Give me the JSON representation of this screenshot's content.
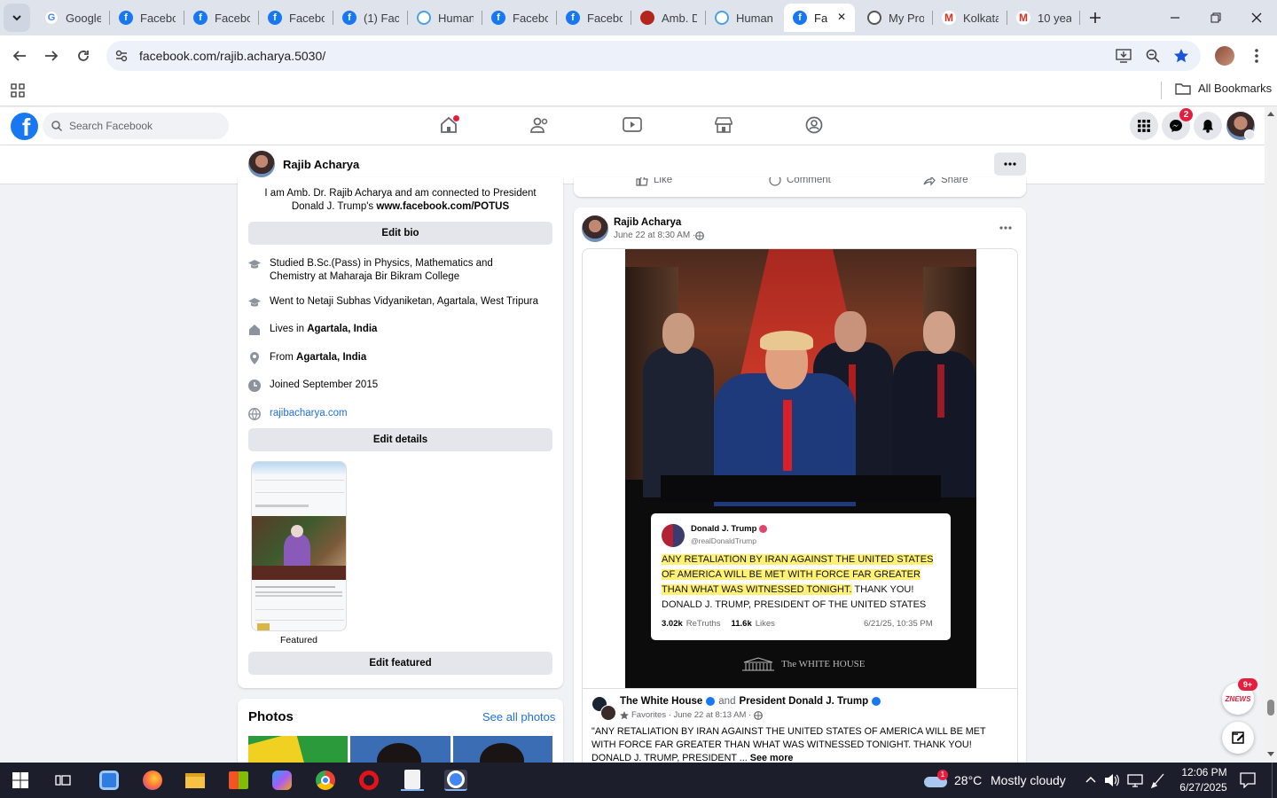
{
  "browser": {
    "tabs": [
      {
        "label": "Google",
        "favicon": "google-icon"
      },
      {
        "label": "Facebo",
        "favicon": "facebook-icon"
      },
      {
        "label": "Facebo",
        "favicon": "facebook-icon"
      },
      {
        "label": "Facebo",
        "favicon": "facebook-icon"
      },
      {
        "label": "(1) Fac",
        "favicon": "facebook-icon"
      },
      {
        "label": "Human",
        "favicon": "globe-icon"
      },
      {
        "label": "Facebo",
        "favicon": "facebook-icon"
      },
      {
        "label": "Facebo",
        "favicon": "facebook-icon"
      },
      {
        "label": "Amb. D",
        "favicon": "avatar-icon"
      },
      {
        "label": "Human",
        "favicon": "globe-icon"
      },
      {
        "label": "Fa",
        "favicon": "facebook-icon"
      },
      {
        "label": "My Pro",
        "favicon": "world-icon"
      },
      {
        "label": "Kolkata",
        "favicon": "gmail-icon"
      },
      {
        "label": "10 yea",
        "favicon": "gmail-icon"
      }
    ],
    "url": "facebook.com/rajib.acharya.5030/",
    "bookmarks_label": "All Bookmarks"
  },
  "facebook": {
    "search_placeholder": "Search Facebook",
    "messenger_badge": "2",
    "profile_name": "Rajib Acharya"
  },
  "intro": {
    "bio": "I am Amb. Dr. Rajib Acharya and am connected to President Donald J. Trump's",
    "bio_link": "www.facebook.com/POTUS",
    "edit_bio": "Edit bio",
    "studied": "Studied B.Sc.(Pass) in Physics, Mathematics and Chemistry at Maharaja Bir Bikram College",
    "went_to": "Went to Netaji Subhas Vidyaniketan, Agartala, West Tripura",
    "lives_prefix": "Lives in ",
    "lives": "Agartala, India",
    "from_prefix": "From ",
    "from": "Agartala, India",
    "joined": "Joined September 2015",
    "website": "rajibacharya.com",
    "edit_details": "Edit details",
    "featured_label": "Featured",
    "edit_featured": "Edit featured"
  },
  "photos": {
    "title": "Photos",
    "see_all": "See all photos"
  },
  "prev_post_actions": {
    "like": "Like",
    "comment": "Comment",
    "share": "Share"
  },
  "post": {
    "author": "Rajib Acharya",
    "time": "June 22 at 8:30 AM · ",
    "tweet": {
      "name": "Donald J. Trump",
      "handle": "@realDonaldTrump",
      "highlight": "ANY RETALIATION BY IRAN AGAINST THE UNITED STATES OF AMERICA WILL BE MET WITH FORCE FAR GREATER THAN WHAT WAS WITNESSED TONIGHT.",
      "rest": " THANK YOU! DONALD J. TRUMP, PRESIDENT OF THE UNITED STATES",
      "retruths": "3.02k",
      "retruths_label": "ReTruths",
      "likes": "11.6k",
      "likes_label": "Likes",
      "date": "6/21/25, 10:35 PM"
    },
    "watermark": "The WHITE HOUSE",
    "shared_from_1": "The White House",
    "shared_and": "and",
    "shared_from_2": "President Donald J. Trump",
    "shared_meta": "Favorites · June 22 at 8:13 AM · ",
    "shared_text": "\"ANY RETALIATION BY IRAN AGAINST THE UNITED STATES OF AMERICA WILL BE MET WITH FORCE FAR GREATER THAN WHAT WAS WITNESSED TONIGHT. THANK YOU! DONALD J. TRUMP, PRESIDENT ...",
    "see_more": "See more"
  },
  "news_widget": {
    "badge": "9+",
    "label": "ZNEWS"
  },
  "taskbar": {
    "temperature": "28°C",
    "weather": "Mostly cloudy",
    "weather_badge": "1",
    "time": "12:06 PM",
    "date": "6/27/2025"
  },
  "colors": {
    "fb_blue": "#1877f2",
    "tab_strip": "#dfe3eb",
    "taskbar": "#1c1e2b",
    "highlight": "#fff176"
  }
}
